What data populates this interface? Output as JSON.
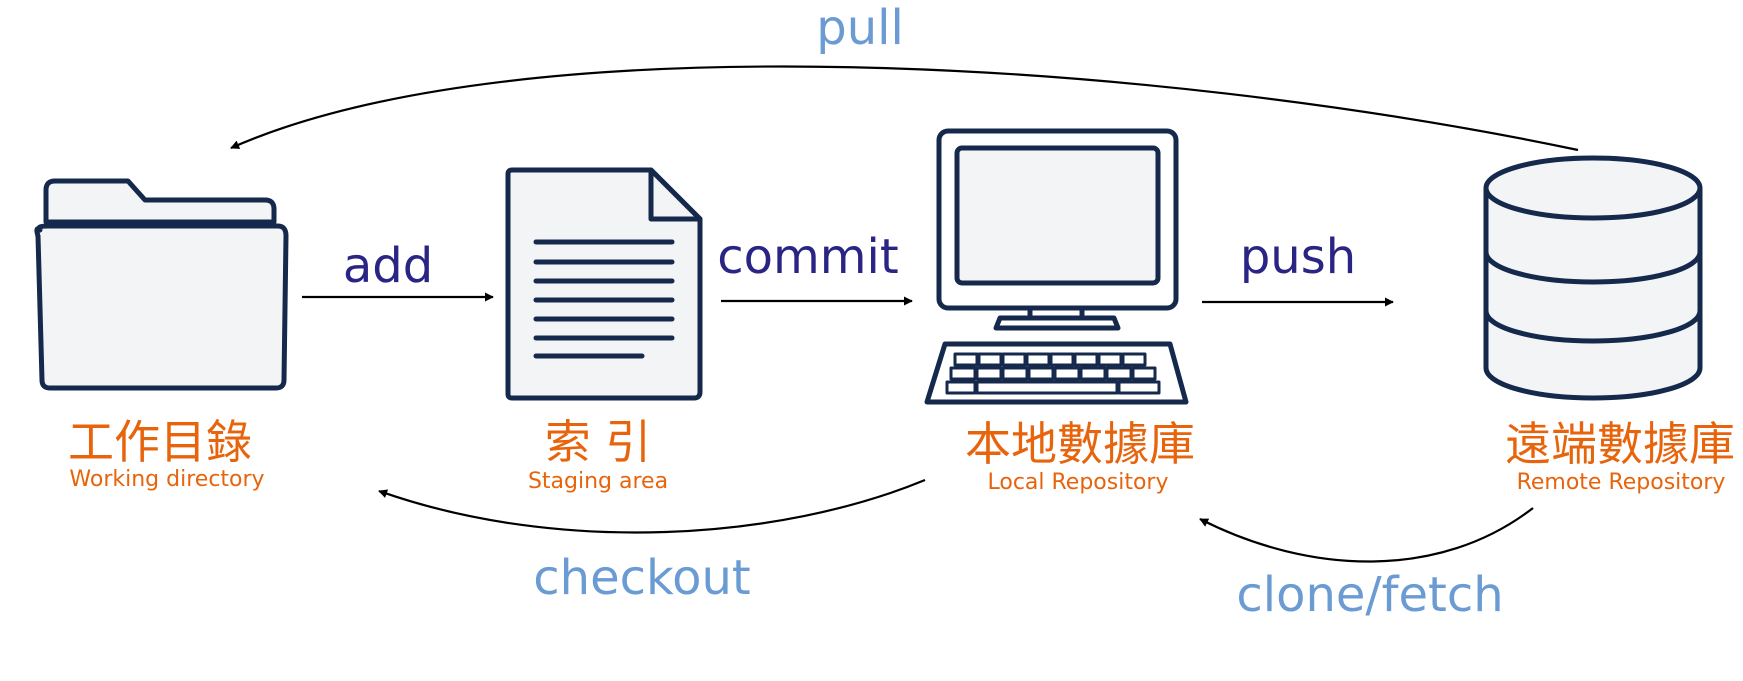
{
  "colors": {
    "outline": "#14294b",
    "fill": "#f3f4f6",
    "node_text": "#e8640c",
    "forward_label": "#2a2484",
    "backward_label": "#6a9bd3",
    "arrow": "#000000"
  },
  "nodes": {
    "working": {
      "title": "工作目錄",
      "subtitle": "Working directory",
      "icon": "folder-icon"
    },
    "staging": {
      "title": "索 引",
      "subtitle": "Staging area",
      "icon": "document-icon"
    },
    "local": {
      "title": "本地數據庫",
      "subtitle": "Local Repository",
      "icon": "computer-icon"
    },
    "remote": {
      "title": "遠端數據庫",
      "subtitle": "Remote Repository",
      "icon": "database-icon"
    }
  },
  "edges": {
    "add": "add",
    "commit": "commit",
    "push": "push",
    "pull": "pull",
    "checkout": "checkout",
    "clone_fetch": "clone/fetch"
  }
}
